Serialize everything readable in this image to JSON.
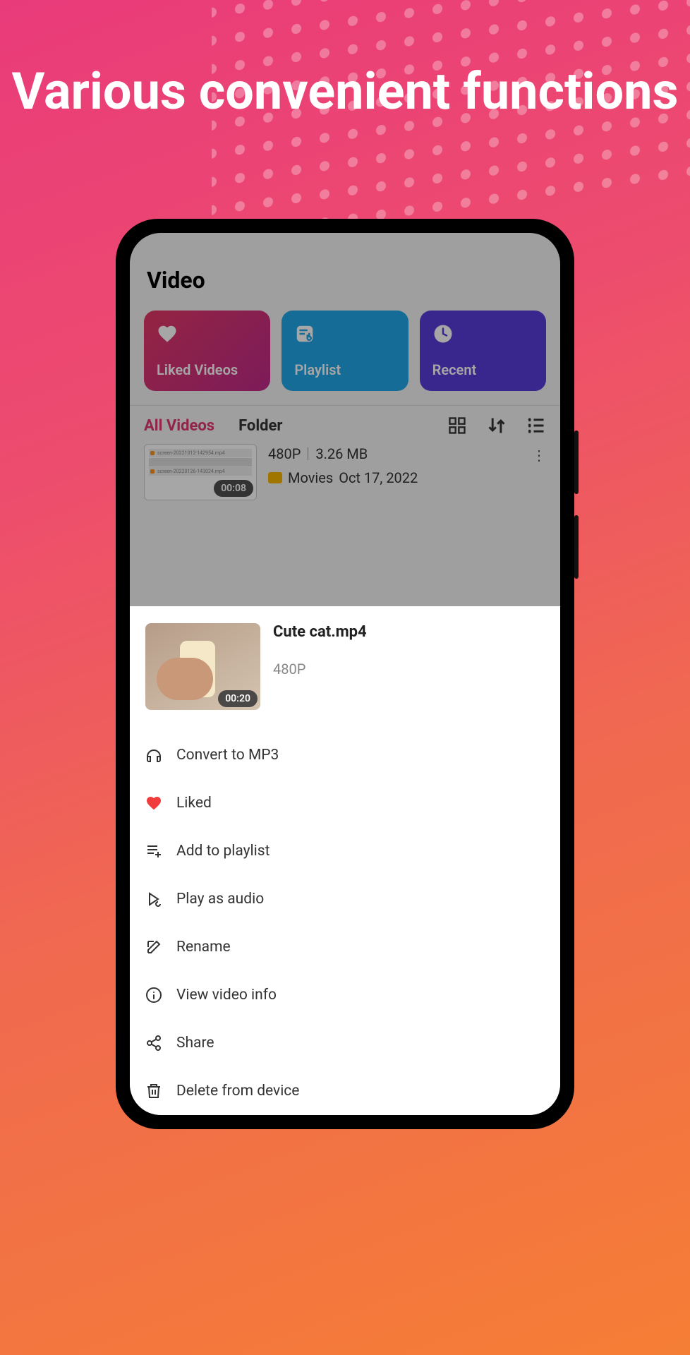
{
  "marketing_headline": "Various convenient functions",
  "header": {
    "title": "Video"
  },
  "cards": {
    "liked": {
      "label": "Liked Videos"
    },
    "playlist": {
      "label": "Playlist"
    },
    "recent": {
      "label": "Recent"
    }
  },
  "tabs": {
    "all": "All Videos",
    "folder": "Folder"
  },
  "bg_video": {
    "resolution": "480P",
    "size": "3.26 MB",
    "folder": "Movies",
    "date": "Oct 17, 2022",
    "duration": "00:08"
  },
  "sheet": {
    "title": "Cute cat.mp4",
    "resolution": "480P",
    "duration": "00:20",
    "items": {
      "convert": "Convert to MP3",
      "liked": "Liked",
      "add_playlist": "Add to playlist",
      "play_audio": "Play as audio",
      "rename": "Rename",
      "info": "View video info",
      "share": "Share",
      "delete": "Delete from device"
    }
  }
}
